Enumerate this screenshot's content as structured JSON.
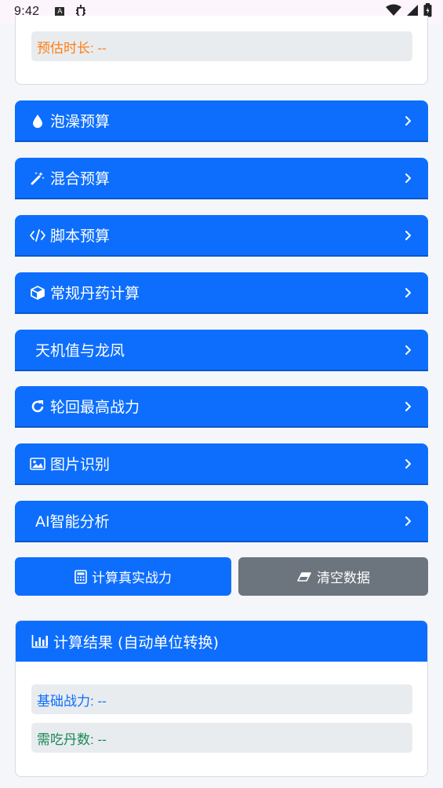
{
  "status_bar": {
    "time": "9:42"
  },
  "estimate": {
    "label": "预估时长: --"
  },
  "sections": [
    {
      "icon": "droplet-icon",
      "label": "泡澡预算"
    },
    {
      "icon": "magic-wand-icon",
      "label": "混合预算"
    },
    {
      "icon": "code-icon",
      "label": "脚本预算"
    },
    {
      "icon": "cube-icon",
      "label": "常规丹药计算"
    },
    {
      "icon": "",
      "label": "天机值与龙凤"
    },
    {
      "icon": "refresh-icon",
      "label": "轮回最高战力"
    },
    {
      "icon": "image-icon",
      "label": "图片识别"
    },
    {
      "icon": "",
      "label": "AI智能分析"
    }
  ],
  "actions": {
    "calculate_label": "计算真实战力",
    "clear_label": "清空数据"
  },
  "results": {
    "title": "计算结果 (自动单位转换)",
    "base_power": "基础战力: --",
    "pills_needed": "需吃丹数: --"
  },
  "colors": {
    "primary": "#0d6efd",
    "secondary": "#6c757d",
    "orange": "#fd7e14",
    "green": "#198754"
  }
}
